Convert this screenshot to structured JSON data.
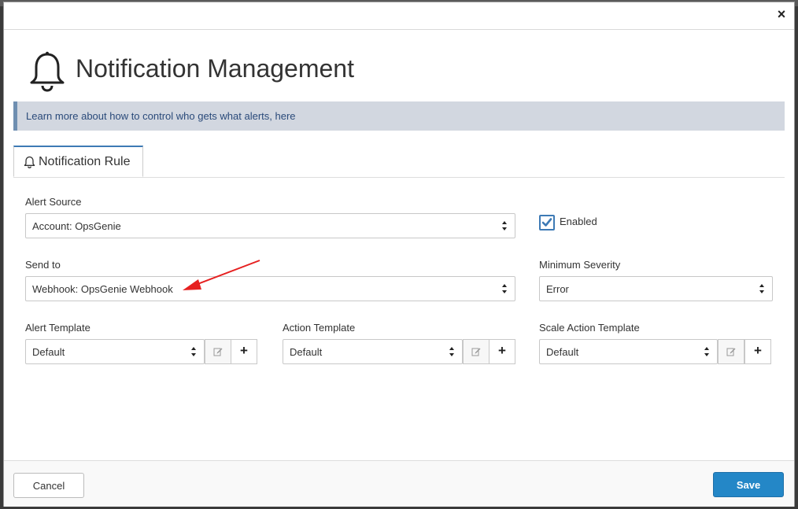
{
  "dialog": {
    "title": "Notification Management",
    "close_label": "×"
  },
  "info": {
    "text": "Learn more about how to control who gets what alerts, ",
    "link_text": "here"
  },
  "tabs": [
    {
      "label": "Notification Rule",
      "active": true
    }
  ],
  "form": {
    "alert_source": {
      "label": "Alert Source",
      "value": "Account: OpsGenie"
    },
    "enabled": {
      "label": "Enabled",
      "checked": true
    },
    "send_to": {
      "label": "Send to",
      "value": "Webhook: OpsGenie Webhook"
    },
    "minimum_severity": {
      "label": "Minimum Severity",
      "value": "Error"
    },
    "alert_template": {
      "label": "Alert Template",
      "value": "Default",
      "add_label": "+"
    },
    "action_template": {
      "label": "Action Template",
      "value": "Default",
      "add_label": "+"
    },
    "scale_action_template": {
      "label": "Scale Action Template",
      "value": "Default",
      "add_label": "+"
    }
  },
  "footer": {
    "cancel_label": "Cancel",
    "save_label": "Save"
  },
  "colors": {
    "accent": "#2487c7",
    "info_bg": "#d2d7e0",
    "annotation_arrow": "#e62020"
  }
}
